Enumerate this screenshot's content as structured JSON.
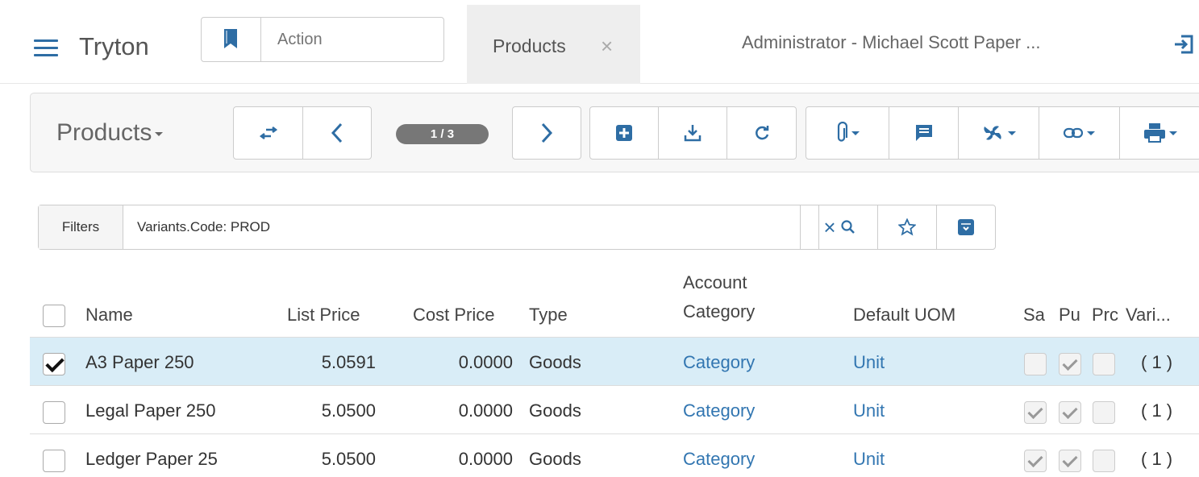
{
  "navbar": {
    "brand": "Tryton",
    "action_placeholder": "Action",
    "tab_label": "Products",
    "tab_close": "×",
    "user_label": "Administrator - Michael Scott Paper ..."
  },
  "toolbar": {
    "title": "Products",
    "counter": "1 / 3"
  },
  "filter": {
    "label": "Filters",
    "value": "Variants.Code: PROD",
    "clear": "×"
  },
  "table": {
    "headers": {
      "name": "Name",
      "list_price": "List Price",
      "cost_price": "Cost Price",
      "type": "Type",
      "account_category_1": "Account",
      "account_category_2": "Category",
      "default_uom": "Default UOM",
      "salable": "Sa",
      "purchasable": "Pu",
      "producible": "Prc",
      "variants": "Vari..."
    },
    "rows": [
      {
        "selected": true,
        "name": "A3 Paper 250",
        "list_price": "5.0591",
        "cost_price": "0.0000",
        "type": "Goods",
        "account_category": "Category",
        "default_uom": "Unit",
        "salable": false,
        "purchasable": true,
        "producible": false,
        "variants": "( 1 )"
      },
      {
        "selected": false,
        "name": "Legal Paper 250",
        "list_price": "5.0500",
        "cost_price": "0.0000",
        "type": "Goods",
        "account_category": "Category",
        "default_uom": "Unit",
        "salable": true,
        "purchasable": true,
        "producible": false,
        "variants": "( 1 )"
      },
      {
        "selected": false,
        "name": "Ledger Paper 25",
        "list_price": "5.0500",
        "cost_price": "0.0000",
        "type": "Goods",
        "account_category": "Category",
        "default_uom": "Unit",
        "salable": true,
        "purchasable": true,
        "producible": false,
        "variants": "( 1 )"
      }
    ]
  },
  "colors": {
    "accent": "#2e6da4",
    "link": "#3276b1",
    "selected_row": "#d9edf7"
  }
}
